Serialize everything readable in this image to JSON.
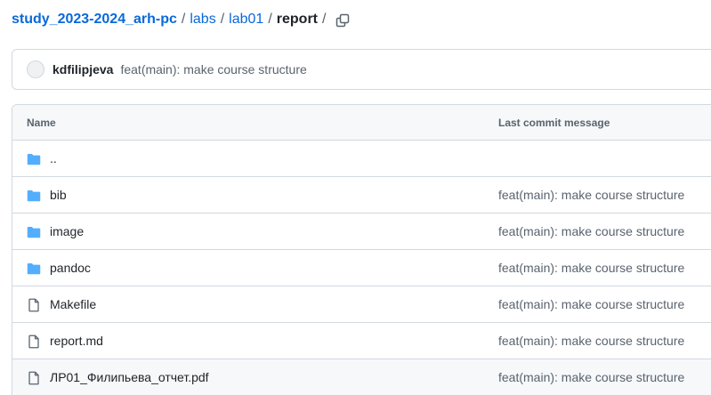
{
  "breadcrumb": {
    "repo": "study_2023-2024_arh-pc",
    "sep": "/",
    "path": [
      "labs",
      "lab01"
    ],
    "current": "report"
  },
  "commit": {
    "author": "kdfilipjeva",
    "message": "feat(main): make course structure"
  },
  "table": {
    "headers": {
      "name": "Name",
      "last_commit": "Last commit message"
    },
    "rows": [
      {
        "type": "folder",
        "name": "..",
        "message": ""
      },
      {
        "type": "folder",
        "name": "bib",
        "message": "feat(main): make course structure"
      },
      {
        "type": "folder",
        "name": "image",
        "message": "feat(main): make course structure"
      },
      {
        "type": "folder",
        "name": "pandoc",
        "message": "feat(main): make course structure"
      },
      {
        "type": "file",
        "name": "Makefile",
        "message": "feat(main): make course structure"
      },
      {
        "type": "file",
        "name": "report.md",
        "message": "feat(main): make course structure"
      },
      {
        "type": "file",
        "name": "ЛР01_Филипьева_отчет.pdf",
        "message": "feat(main): make course structure"
      }
    ]
  },
  "icons": {
    "folder": "folder-icon",
    "file": "file-icon",
    "copy": "copy-icon"
  },
  "colors": {
    "link": "#0969da",
    "folder": "#54aeff",
    "muted": "#59636e",
    "border": "#d1d9e0",
    "header_bg": "#f6f8fa"
  }
}
